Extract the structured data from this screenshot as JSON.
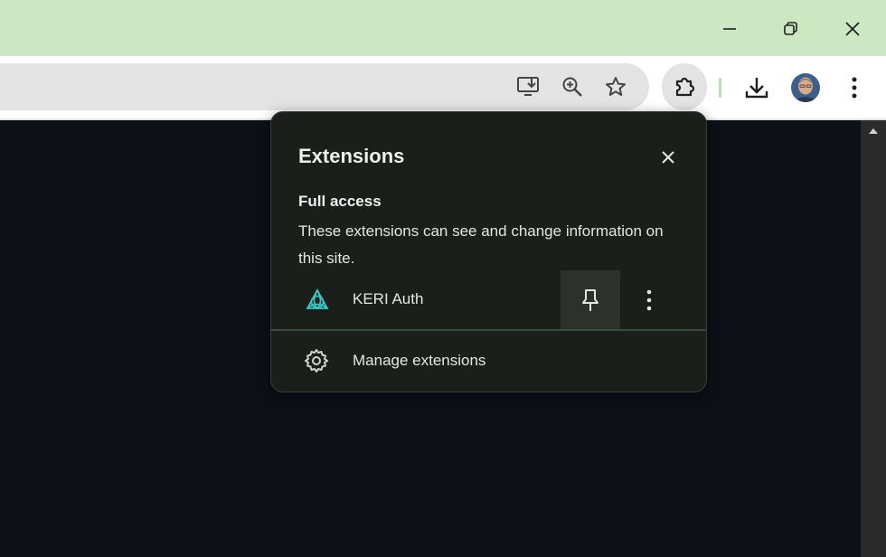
{
  "window": {
    "titlebar_color": "#cce8c2",
    "controls": [
      {
        "name": "minimize-icon"
      },
      {
        "name": "restore-icon"
      },
      {
        "name": "close-icon"
      }
    ]
  },
  "toolbar": {
    "icons": [
      "install-app-icon",
      "zoom-icon",
      "bookmark-star-icon",
      "extensions-puzzle-icon",
      "download-icon",
      "profile-avatar",
      "more-vert-icon"
    ]
  },
  "extensions_popup": {
    "title": "Extensions",
    "section_title": "Full access",
    "section_description": "These extensions can see and change information on this site.",
    "extensions": [
      {
        "name": "KERI Auth",
        "icon": "keri-triquetra-icon",
        "accent": "#39c8c4"
      }
    ],
    "manage_label": "Manage extensions"
  },
  "colors": {
    "page_background": "#0d1017",
    "popup_background": "#1b1f1b",
    "toolbar_background": "#ffffff"
  }
}
